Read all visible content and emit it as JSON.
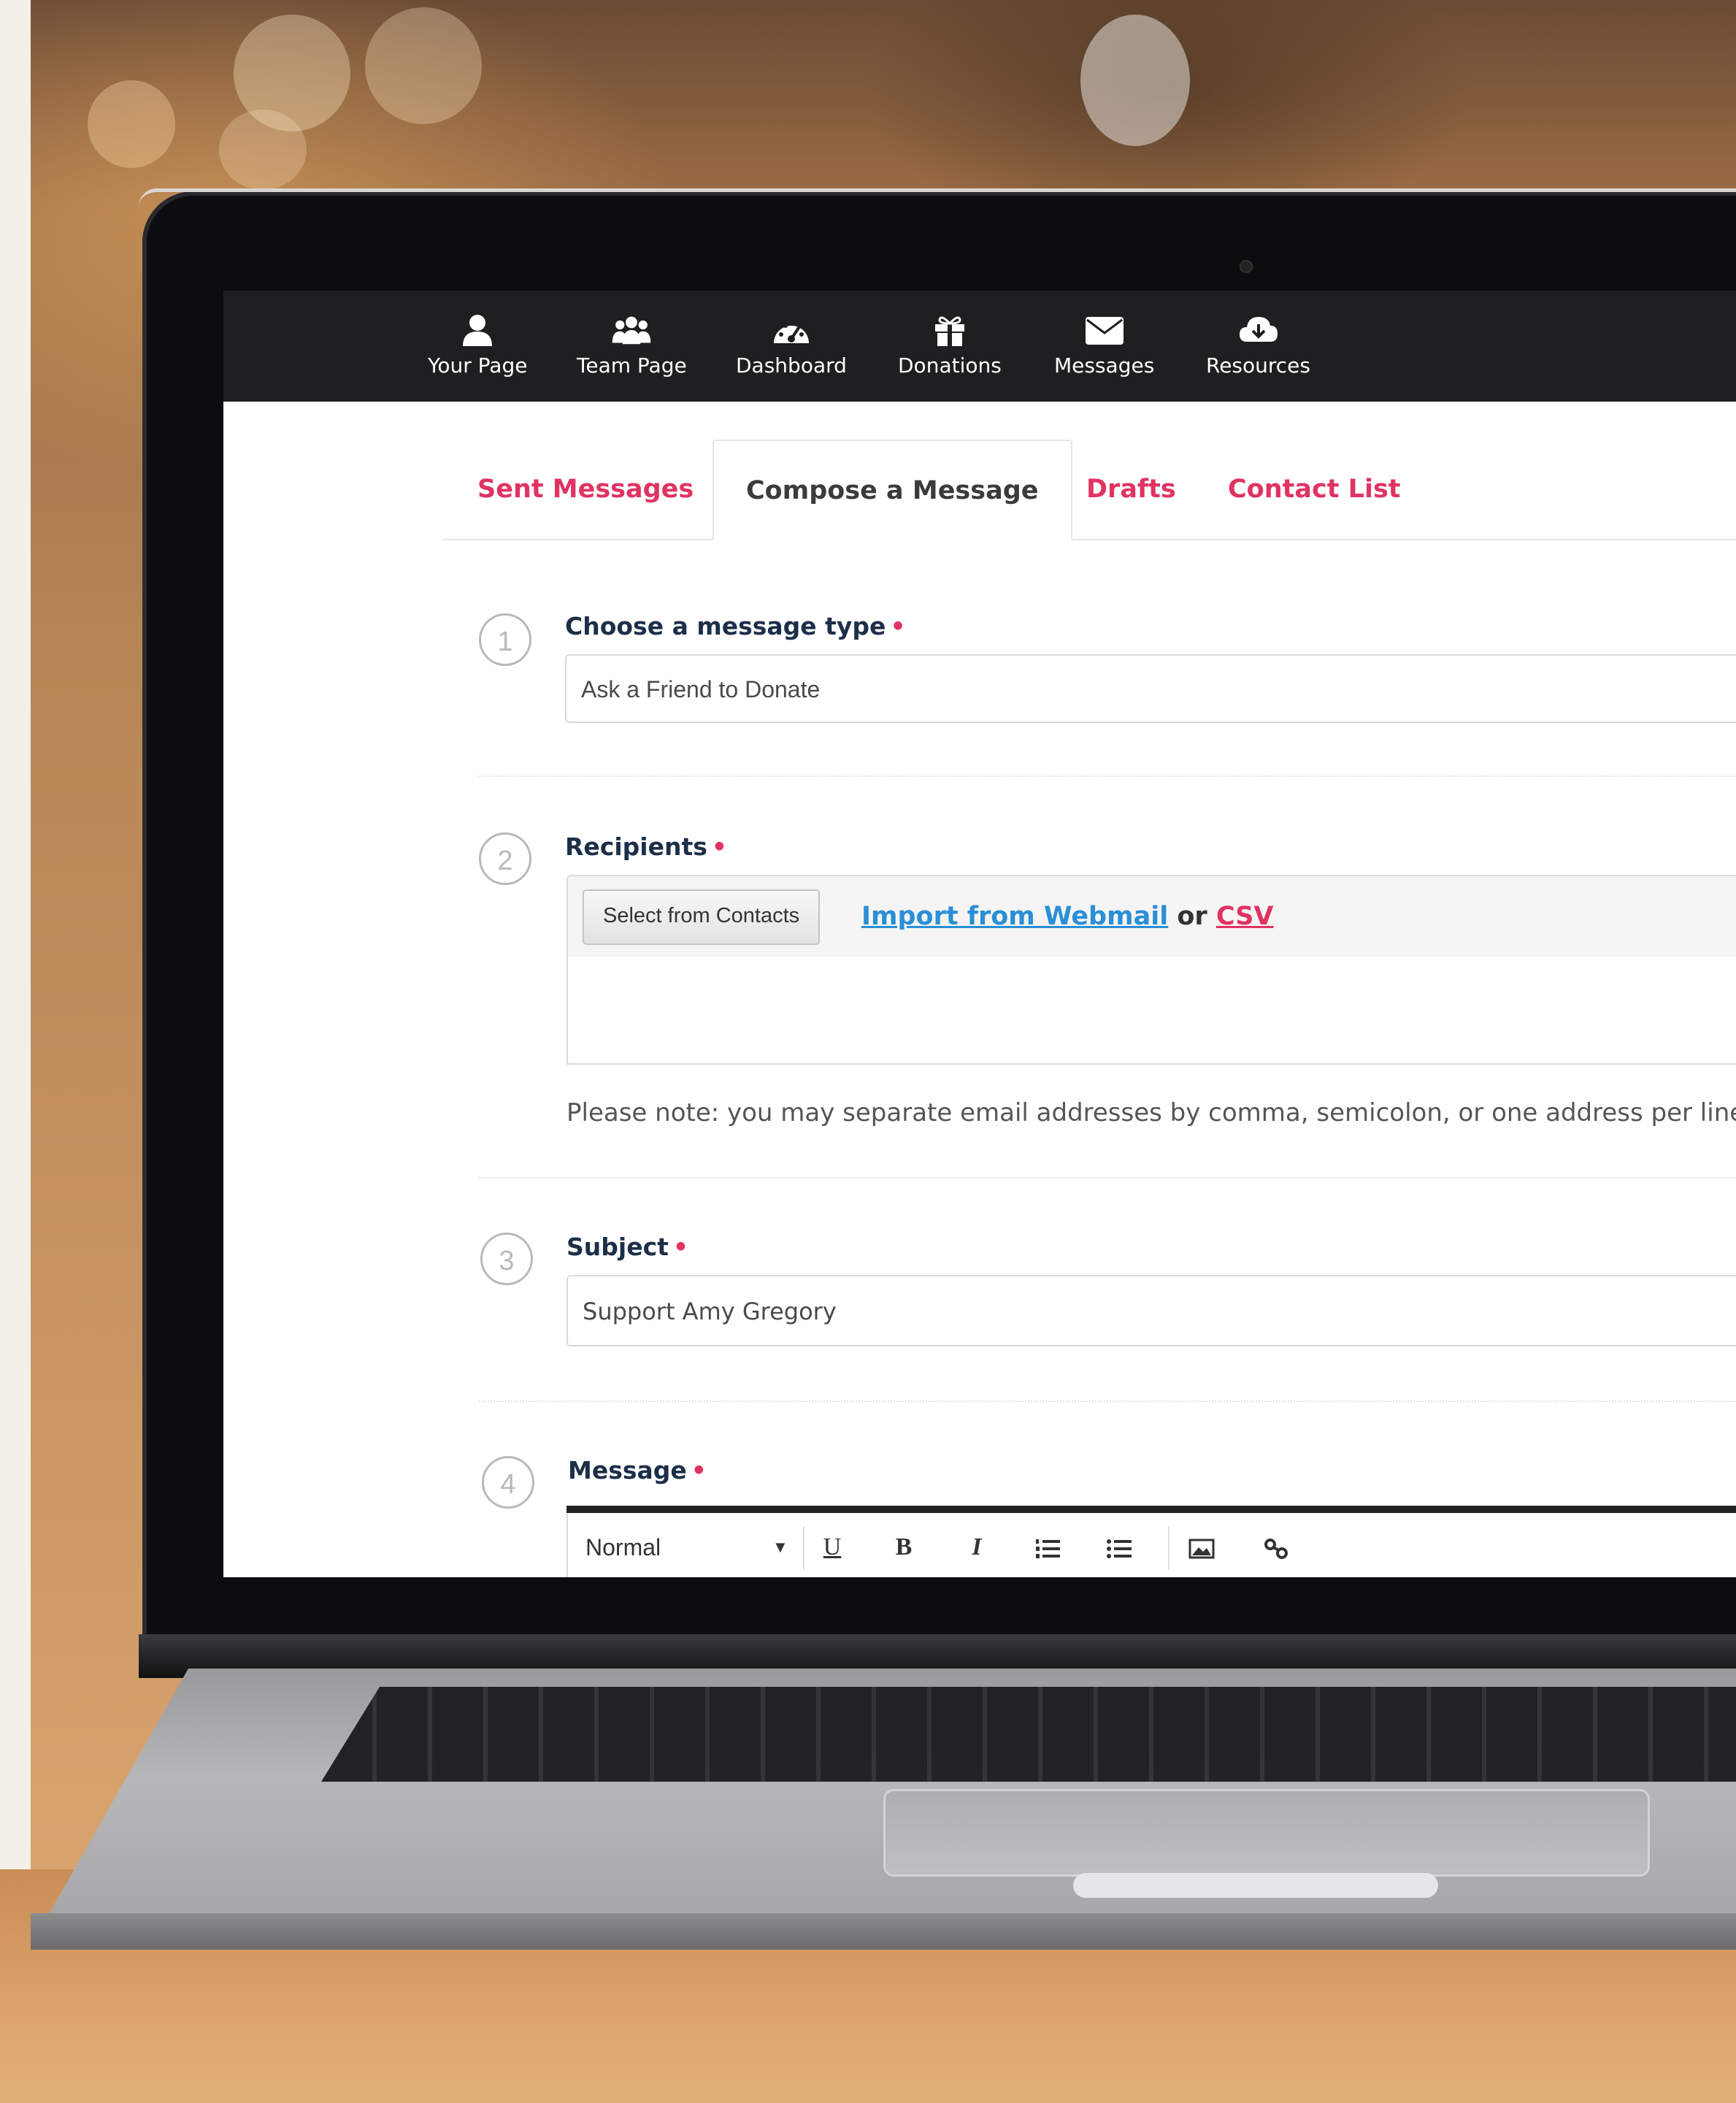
{
  "nav": {
    "items": [
      {
        "label": "Your Page",
        "icon": "user-icon"
      },
      {
        "label": "Team Page",
        "icon": "team-icon"
      },
      {
        "label": "Dashboard",
        "icon": "dashboard-icon"
      },
      {
        "label": "Donations",
        "icon": "gift-icon"
      },
      {
        "label": "Messages",
        "icon": "envelope-icon"
      },
      {
        "label": "Resources",
        "icon": "cloud-download-icon"
      }
    ]
  },
  "tabs": {
    "sent": "Sent Messages",
    "compose": "Compose a Message",
    "drafts": "Drafts",
    "contacts": "Contact List",
    "active": "compose"
  },
  "form": {
    "step1": {
      "num": "1",
      "label": "Choose a message type",
      "required": "•",
      "value": "Ask a Friend to Donate"
    },
    "step2": {
      "num": "2",
      "label": "Recipients",
      "required": "•",
      "select_button": "Select from Contacts",
      "import_link": "Import from Webmail",
      "or_text": "or",
      "csv_link": "CSV",
      "recipients_value": "",
      "note": "Please note: you may separate email addresses by comma, semicolon, or one address per line."
    },
    "step3": {
      "num": "3",
      "label": "Subject",
      "required": "•",
      "value": "Support Amy Gregory"
    },
    "step4": {
      "num": "4",
      "label": "Message",
      "required": "•",
      "format_select": "Normal",
      "toolbar": [
        "underline",
        "bold",
        "italic",
        "ordered-list",
        "bullet-list",
        "image",
        "link"
      ]
    }
  },
  "colors": {
    "accent": "#e03362",
    "link": "#2a8fd6",
    "label": "#1d2f48",
    "nav_bg": "#1f1f21"
  }
}
